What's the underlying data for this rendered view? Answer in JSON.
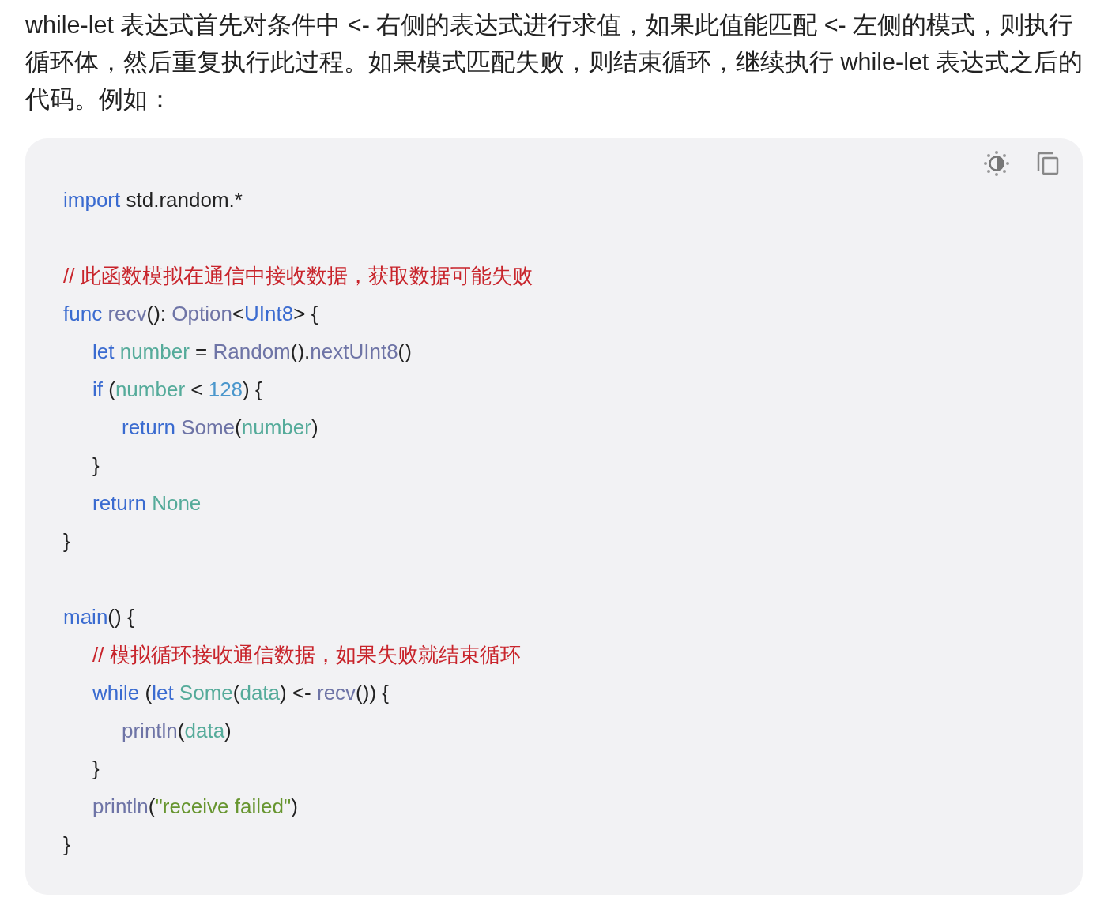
{
  "paragraph": "while-let 表达式首先对条件中 <- 右侧的表达式进行求值，如果此值能匹配 <- 左侧的模式，则执行循环体，然后重复执行此过程。如果模式匹配失败，则结束循环，继续执行 while-let 表达式之后的代码。例如：",
  "code_block": {
    "lines": [
      {
        "kind": "code",
        "tokens": [
          {
            "kind": "keyword",
            "text": "import"
          },
          {
            "kind": "plain",
            "text": " std.random.*"
          }
        ]
      },
      {
        "kind": "blank"
      },
      {
        "kind": "code",
        "tokens": [
          {
            "kind": "comment",
            "text": "// 此函数模拟在通信中接收数据，获取数据可能失败"
          }
        ]
      },
      {
        "kind": "code",
        "tokens": [
          {
            "kind": "keyword",
            "text": "func "
          },
          {
            "kind": "function",
            "text": "recv"
          },
          {
            "kind": "plain",
            "text": "(): "
          },
          {
            "kind": "function",
            "text": "Option"
          },
          {
            "kind": "plain",
            "text": "<"
          },
          {
            "kind": "keyword",
            "text": "UInt8"
          },
          {
            "kind": "plain",
            "text": "> {"
          }
        ],
        "children": [
          {
            "kind": "code",
            "tokens": [
              {
                "kind": "keyword",
                "text": "let "
              },
              {
                "kind": "variable",
                "text": "number"
              },
              {
                "kind": "plain",
                "text": " = "
              },
              {
                "kind": "function",
                "text": "Random"
              },
              {
                "kind": "plain",
                "text": "()."
              },
              {
                "kind": "function",
                "text": "nextUInt8"
              },
              {
                "kind": "plain",
                "text": "()"
              }
            ]
          },
          {
            "kind": "code",
            "tokens": [
              {
                "kind": "keyword",
                "text": "if"
              },
              {
                "kind": "plain",
                "text": " ("
              },
              {
                "kind": "variable",
                "text": "number"
              },
              {
                "kind": "plain",
                "text": " < "
              },
              {
                "kind": "number",
                "text": "128"
              },
              {
                "kind": "plain",
                "text": ") {"
              }
            ],
            "children": [
              {
                "kind": "code",
                "tokens": [
                  {
                    "kind": "keyword",
                    "text": "return "
                  },
                  {
                    "kind": "function",
                    "text": "Some"
                  },
                  {
                    "kind": "plain",
                    "text": "("
                  },
                  {
                    "kind": "variable",
                    "text": "number"
                  },
                  {
                    "kind": "plain",
                    "text": ")"
                  }
                ]
              }
            ]
          },
          {
            "kind": "code",
            "tokens": [
              {
                "kind": "plain",
                "text": "}"
              }
            ]
          },
          {
            "kind": "code",
            "tokens": [
              {
                "kind": "keyword",
                "text": "return "
              },
              {
                "kind": "variable",
                "text": "None"
              }
            ]
          }
        ]
      },
      {
        "kind": "code",
        "tokens": [
          {
            "kind": "plain",
            "text": "}"
          }
        ]
      },
      {
        "kind": "blank"
      },
      {
        "kind": "code",
        "tokens": [
          {
            "kind": "keyword",
            "text": "main"
          },
          {
            "kind": "plain",
            "text": "() {"
          }
        ],
        "children": [
          {
            "kind": "code",
            "tokens": [
              {
                "kind": "comment",
                "text": "// 模拟循环接收通信数据，如果失败就结束循环"
              }
            ]
          },
          {
            "kind": "code",
            "tokens": [
              {
                "kind": "keyword",
                "text": "while"
              },
              {
                "kind": "plain",
                "text": " ("
              },
              {
                "kind": "keyword",
                "text": "let "
              },
              {
                "kind": "variable",
                "text": "Some"
              },
              {
                "kind": "plain",
                "text": "("
              },
              {
                "kind": "variable",
                "text": "data"
              },
              {
                "kind": "plain",
                "text": ") <- "
              },
              {
                "kind": "function",
                "text": "recv"
              },
              {
                "kind": "plain",
                "text": "()) {"
              }
            ],
            "children": [
              {
                "kind": "code",
                "tokens": [
                  {
                    "kind": "function",
                    "text": "println"
                  },
                  {
                    "kind": "plain",
                    "text": "("
                  },
                  {
                    "kind": "variable",
                    "text": "data"
                  },
                  {
                    "kind": "plain",
                    "text": ")"
                  }
                ]
              }
            ]
          },
          {
            "kind": "code",
            "tokens": [
              {
                "kind": "plain",
                "text": "}"
              }
            ]
          },
          {
            "kind": "code",
            "tokens": [
              {
                "kind": "function",
                "text": "println"
              },
              {
                "kind": "plain",
                "text": "("
              },
              {
                "kind": "string",
                "text": "\"receive failed\""
              },
              {
                "kind": "plain",
                "text": ")"
              }
            ]
          }
        ]
      },
      {
        "kind": "code",
        "tokens": [
          {
            "kind": "plain",
            "text": "}"
          }
        ]
      }
    ]
  }
}
